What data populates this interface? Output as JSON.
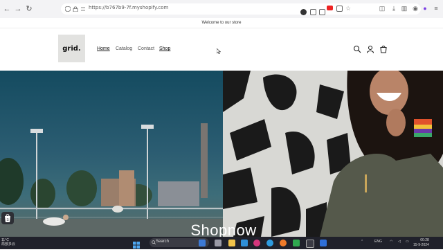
{
  "browser": {
    "url": "https://b767b9-7f.myshopify.com",
    "nav_icons": [
      "back-icon",
      "forward-icon",
      "refresh-icon"
    ],
    "toolbar_icons": [
      "pocket-icon",
      "download-icon",
      "reader-icon",
      "account-icon",
      "extensions-icon",
      "menu-icon"
    ]
  },
  "announcement": {
    "text": "Welcome to our store"
  },
  "header": {
    "logo_text": "grid.",
    "menu": [
      {
        "label": "Home",
        "active": true
      },
      {
        "label": "Catalog",
        "active": false
      },
      {
        "label": "Contact",
        "active": false
      },
      {
        "label": "Shop",
        "active": false
      }
    ],
    "icons": [
      "search-icon",
      "account-icon",
      "cart-icon"
    ]
  },
  "hero": {
    "title": "Shopnow"
  },
  "taskbar": {
    "weather_temp": "11°C",
    "weather_desc": "局部多云",
    "search_label": "Search",
    "language": "ENG",
    "time": "00:28",
    "date": "15-9-2024",
    "apps": [
      "start-icon",
      "search-icon",
      "task-view-icon",
      "file-explorer-icon",
      "edge-icon",
      "chrome-icon",
      "firefox-icon",
      "terminal-icon",
      "store-icon",
      "vscode-icon"
    ]
  },
  "colors": {
    "announcement_bg": "#ffffff",
    "hero_left_top": "#144b60",
    "taskbar_bg": "#20212b"
  }
}
